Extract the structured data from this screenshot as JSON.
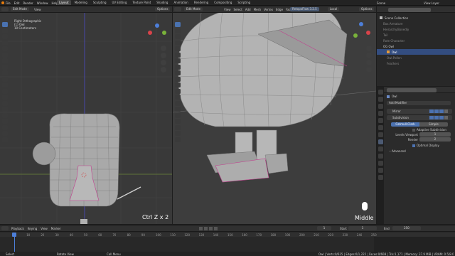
{
  "topbar": {
    "menus": [
      "File",
      "Edit",
      "Render",
      "Window",
      "Help"
    ],
    "tabs": [
      "Layout",
      "Modeling",
      "Sculpting",
      "UV Editing",
      "Texture Paint",
      "Shading",
      "Animation",
      "Rendering",
      "Compositing",
      "Scripting"
    ],
    "active_tab": "Layout",
    "scene": "Scene",
    "view_layer": "View Layer"
  },
  "left_view": {
    "mode": "Edit Mode",
    "view_menu": "View",
    "options": "Options",
    "overlay_lines": [
      "Right Orthographic",
      "(1) Owl",
      "10 Centimeters"
    ],
    "shortcut_text": "Ctrl Z x 2"
  },
  "right_view": {
    "mode": "Edit Mode",
    "menus": [
      "View",
      "Select",
      "Add",
      "Mesh",
      "Vertex",
      "Edge",
      "Face",
      "UV"
    ],
    "addon": "RetopoFlow 3.2.5",
    "transform": "Local",
    "options": "Options",
    "mouse_text": "Middle"
  },
  "outliner": {
    "rows": [
      "Scene Collection",
      "Box.Armature",
      "Hierarchy.Bonedly",
      "Tail",
      "Rote Character",
      "OG Owl",
      "Owl",
      "Owl.Pollen",
      "Feathers"
    ],
    "selected_index": 6
  },
  "properties": {
    "object": "Owl",
    "add_modifier": "Add Modifier",
    "modifiers": [
      "Mirror",
      "Subdivision"
    ],
    "catmull": "Catmull-Clark",
    "simple": "Simple",
    "adaptive": "Adaptive Subdivision",
    "levels_viewport_label": "Levels Viewport",
    "levels_viewport_value": "1",
    "render_label": "Render",
    "render_value": "2",
    "optimal": "Optimal Display",
    "advanced": "Advanced"
  },
  "timeline": {
    "playback": "Playback",
    "keying": "Keying",
    "view": "View",
    "marker": "Marker",
    "current_frame": "1",
    "start_label": "Start",
    "start": "1",
    "end_label": "End",
    "end": "250",
    "ruler": [
      "0",
      "10",
      "20",
      "30",
      "40",
      "50",
      "60",
      "70",
      "80",
      "90",
      "100",
      "110",
      "120",
      "130",
      "140",
      "150",
      "160",
      "170",
      "180",
      "190",
      "200",
      "210",
      "220",
      "230",
      "240",
      "250"
    ]
  },
  "statusbar": {
    "left": "Select",
    "middle": "Rotate View",
    "right": "Call Menu",
    "stats": "Owl | Verts:0/615 | Edges:0/1,222 | Faces:0/608 | Tris:1,171 | Memory: 37.9 MiB | VRAM: 0.5/8.0 GiB"
  }
}
